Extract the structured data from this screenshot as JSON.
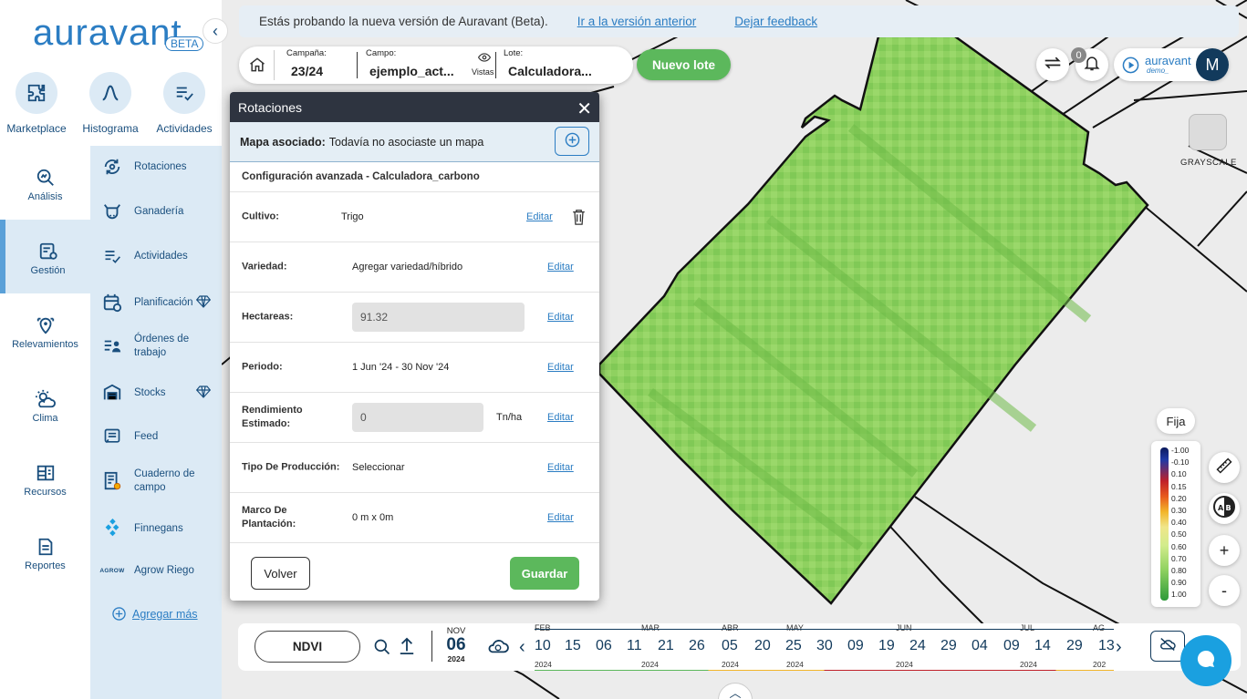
{
  "app": {
    "logo": "auravant",
    "beta_badge": "BETA"
  },
  "quick_actions": [
    {
      "label": "Marketplace",
      "icon": "puzzle-icon"
    },
    {
      "label": "Histograma",
      "icon": "histogram-icon"
    },
    {
      "label": "Actividades",
      "icon": "activities-icon"
    }
  ],
  "nav_left": [
    {
      "label": "Análisis",
      "icon": "analysis-icon"
    },
    {
      "label": "Gestión",
      "icon": "management-icon",
      "active": true
    },
    {
      "label": "Relevamientos",
      "icon": "survey-pin-icon"
    },
    {
      "label": "Clima",
      "icon": "weather-icon"
    },
    {
      "label": "Recursos",
      "icon": "resources-icon"
    },
    {
      "label": "Reportes",
      "icon": "reports-icon"
    }
  ],
  "nav_sub": [
    {
      "label": "Rotaciones",
      "icon": "rotation-icon"
    },
    {
      "label": "Ganadería",
      "icon": "cattle-icon"
    },
    {
      "label": "Actividades",
      "icon": "activities-icon"
    },
    {
      "label": "Planificación",
      "icon": "calendar-icon",
      "premium": true
    },
    {
      "label": "Órdenes de trabajo",
      "icon": "work-order-icon"
    },
    {
      "label": "Stocks",
      "icon": "warehouse-icon",
      "premium": true
    },
    {
      "label": "Feed",
      "icon": "feed-icon"
    },
    {
      "label": "Cuaderno de campo",
      "icon": "notebook-icon"
    },
    {
      "label": "Finnegans",
      "icon": "finnegans-icon"
    },
    {
      "label": "Agrow Riego",
      "icon": "agrow-logo-icon",
      "icon_text": "AGROW"
    }
  ],
  "agregar_mas": "Agregar más",
  "banner": {
    "text": "Estás probando la nueva versión de Auravant (Beta).",
    "link_previous": "Ir a la versión anterior",
    "link_feedback": "Dejar feedback"
  },
  "selector": {
    "campana_label": "Campaña:",
    "campana_value": "23/24",
    "campo_label": "Campo:",
    "campo_value": "ejemplo_act...",
    "vistas_label": "Vistas",
    "lote_label": "Lote:",
    "lote_value": "Calculadora..."
  },
  "nuevo_lote": "Nuevo lote",
  "notifications_count": "0",
  "account": {
    "brand": "auravant",
    "org": "demo_",
    "avatar_letter": "M"
  },
  "grayscale_label": "GRAYSCALE",
  "legend": {
    "mode": "Fija",
    "ticks": [
      "-1.00",
      "-0.10",
      "0.10",
      "0.15",
      "0.20",
      "0.30",
      "0.40",
      "0.50",
      "0.60",
      "0.70",
      "0.80",
      "0.90",
      "1.00"
    ]
  },
  "dialog": {
    "title": "Rotaciones",
    "mapa_label": "Mapa asociado:",
    "mapa_value": "Todavía no asociaste un mapa",
    "config": "Configuración avanzada - Calculadora_carbono",
    "edit_label": "Editar",
    "fields": {
      "cultivo": {
        "label": "Cultivo:",
        "value": "Trigo"
      },
      "variedad": {
        "label": "Variedad:",
        "value": "Agregar variedad/híbrido"
      },
      "hectareas": {
        "label": "Hectareas:",
        "value": "91.32"
      },
      "periodo": {
        "label": "Periodo:",
        "value": "1 Jun '24 - 30 Nov '24"
      },
      "rendimiento": {
        "label": "Rendimiento Estimado:",
        "value": "0",
        "unit": "Tn/ha"
      },
      "tipo": {
        "label": "Tipo De Producción:",
        "value": "Seleccionar"
      },
      "marco": {
        "label": "Marco De Plantación:",
        "value": "0 m x 0m"
      }
    },
    "volver": "Volver",
    "guardar": "Guardar"
  },
  "timeline": {
    "index": "NDVI",
    "selected": {
      "month": "NOV",
      "day": "06",
      "year": "2024"
    },
    "months": [
      "FEB",
      "MAR",
      "ABR",
      "MAY",
      "JUN",
      "JUL",
      "AG"
    ],
    "days": [
      "10",
      "15",
      "06",
      "11",
      "21",
      "26",
      "05",
      "20",
      "25",
      "30",
      "09",
      "19",
      "24",
      "29",
      "04",
      "09",
      "14",
      "29",
      "13"
    ],
    "years": [
      "2024",
      "2024",
      "2024",
      "2024",
      "2024",
      "2024",
      "202"
    ]
  }
}
